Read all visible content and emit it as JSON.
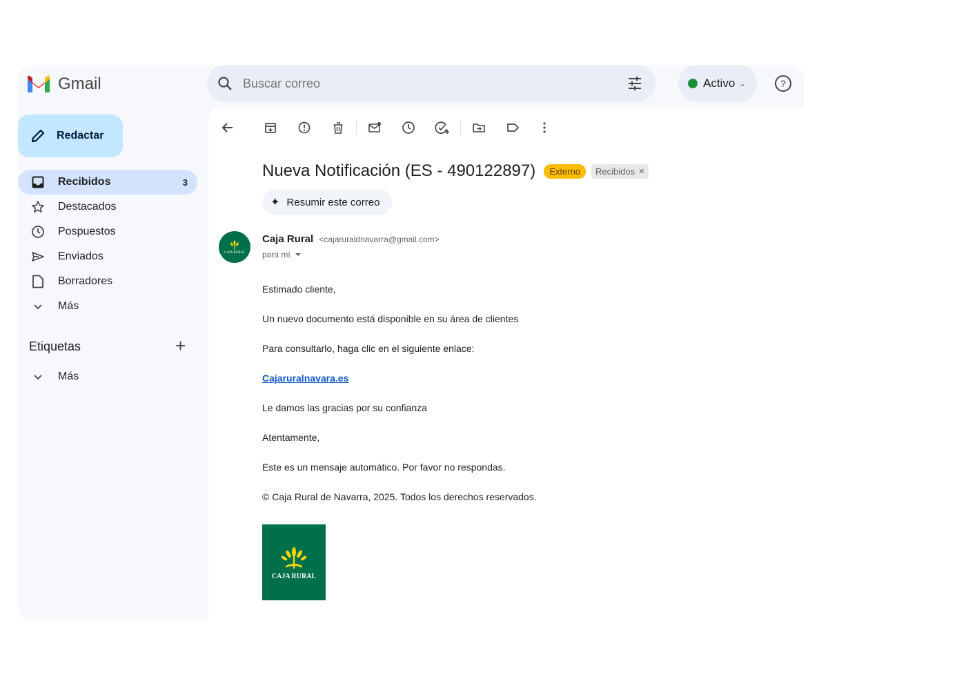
{
  "app": {
    "name": "Gmail"
  },
  "search": {
    "placeholder": "Buscar correo"
  },
  "status": {
    "label": "Activo"
  },
  "compose": {
    "label": "Redactar"
  },
  "nav": {
    "items": [
      {
        "label": "Recibidos",
        "count": "3",
        "icon": "inbox-icon",
        "active": true
      },
      {
        "label": "Destacados",
        "icon": "star-icon"
      },
      {
        "label": "Pospuestos",
        "icon": "clock-icon"
      },
      {
        "label": "Enviados",
        "icon": "send-icon"
      },
      {
        "label": "Borradores",
        "icon": "draft-icon"
      },
      {
        "label": "Más",
        "icon": "chevron-down-icon"
      }
    ]
  },
  "labels": {
    "title": "Etiquetas",
    "more": "Más"
  },
  "message": {
    "subject": "Nueva Notificación (ES - 490122897)",
    "badge_external": "Externo",
    "badge_inbox": "Recibidos",
    "summarize": "Resumir este correo",
    "sender_name": "Caja Rural",
    "sender_email": "<cajaruraldnavarra@gmail.com>",
    "to": "para mí",
    "avatar_text": "CAJA RURAL",
    "body": {
      "greeting": "Estimado cliente,",
      "line1": "Un nuevo documento está disponible en su área de clientes",
      "line2": "Para consultarlo, haga clic en el siguiente enlace:",
      "link": "Cajaruralnavara.es ",
      "line3": "Le damos las gracias por su confianza",
      "closing": "Atentamente,",
      "auto": "Este es un mensaje automático. Por favor no respondas.",
      "copyright": "© Caja Rural de Navarra, 2025. Todos los derechos reservados."
    },
    "logo_text": "CAJA RURAL"
  },
  "colors": {
    "accent": "#0b57d0",
    "compose_bg": "#c2e7ff",
    "active_nav": "#d3e3fd",
    "external_badge": "#fbbc04",
    "brand_green": "#00704a",
    "status_green": "#1e8e3e"
  }
}
